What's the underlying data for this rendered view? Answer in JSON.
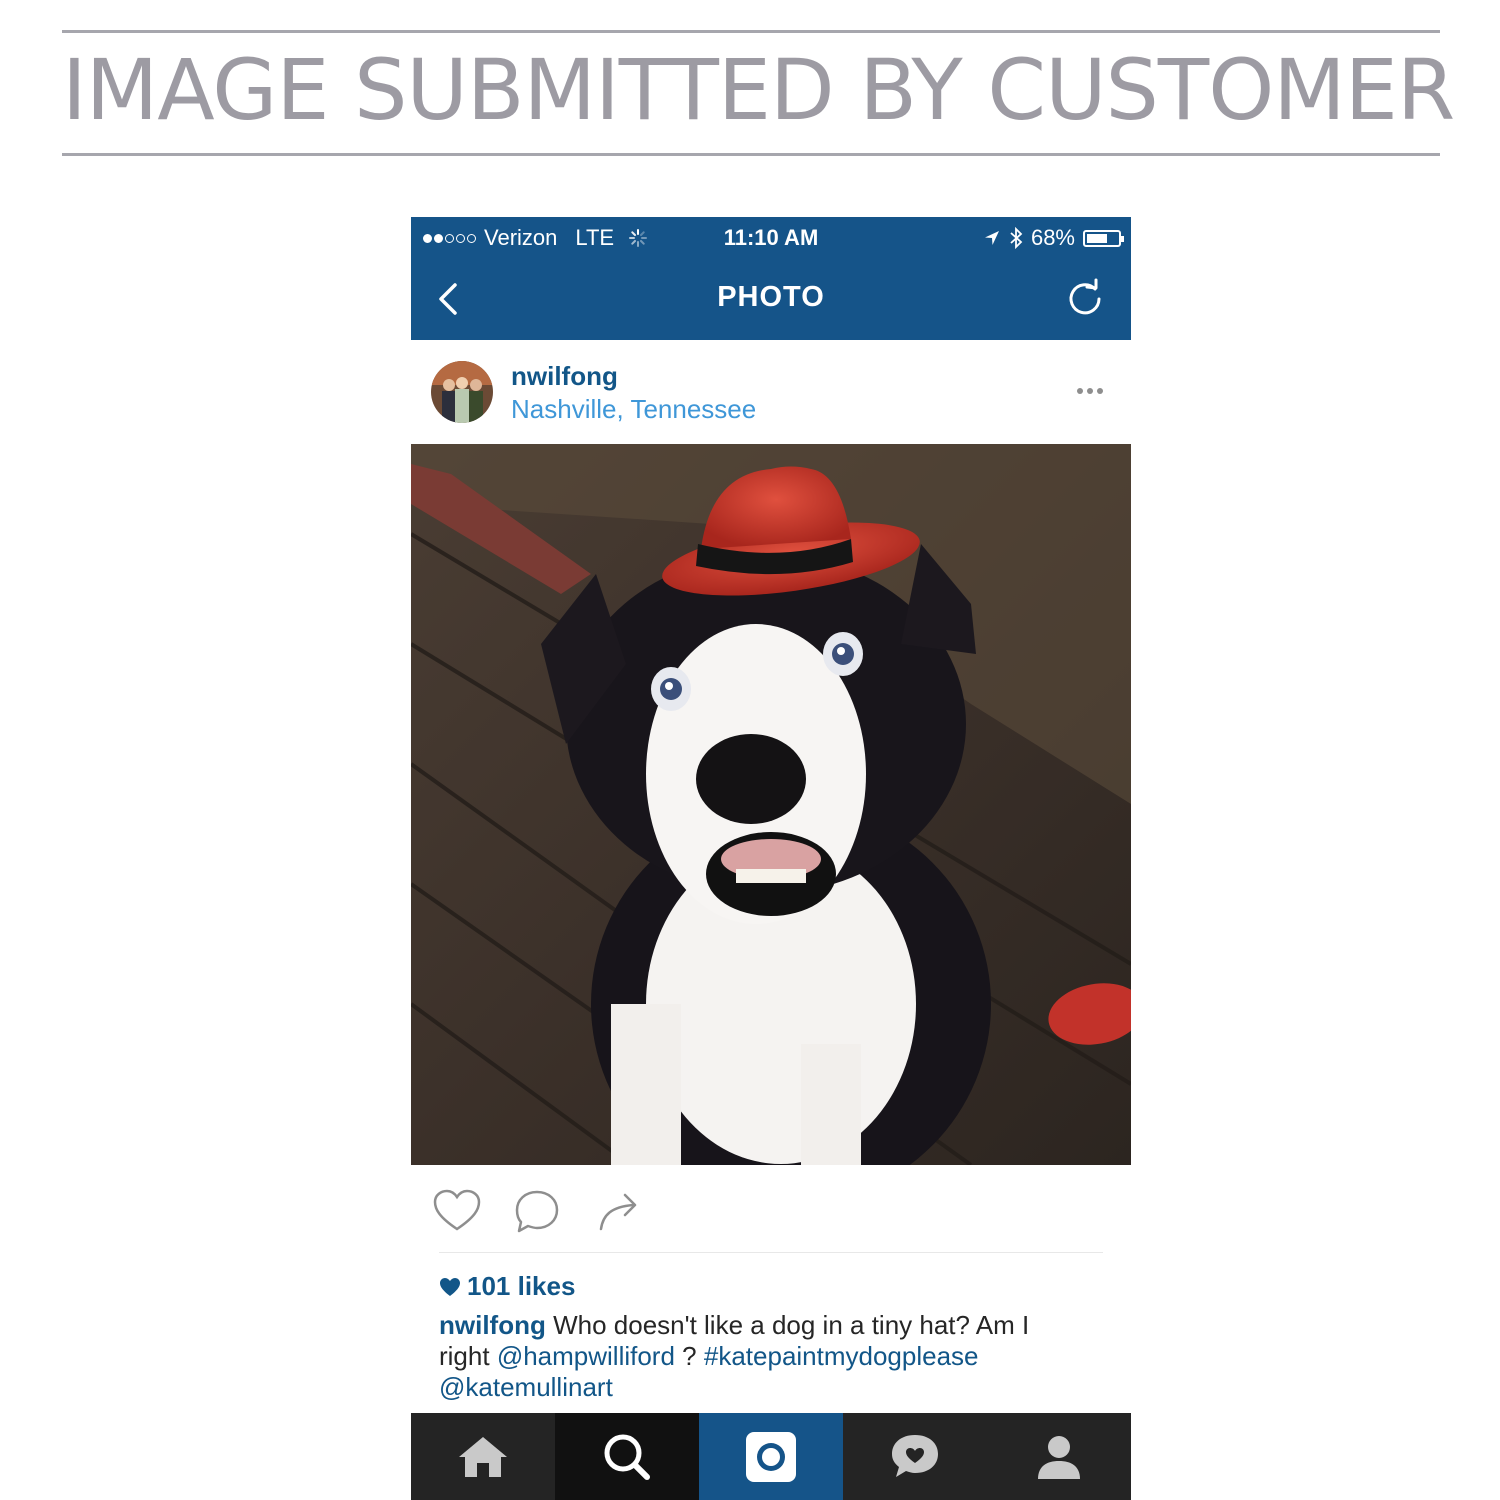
{
  "banner": {
    "title": "IMAGE SUBMITTED BY CUSTOMER"
  },
  "status_bar": {
    "carrier": "Verizon",
    "network": "LTE",
    "time": "11:10 AM",
    "battery": "68%",
    "battery_level": 0.68,
    "signal_bars_filled": 2,
    "signal_bars_total": 5
  },
  "nav": {
    "title": "PHOTO",
    "back_icon": "chevron-left-icon",
    "refresh_icon": "refresh-icon"
  },
  "post": {
    "username": "nwilfong",
    "location": "Nashville, Tennessee",
    "likes": "101 likes",
    "caption": {
      "username": "nwilfong",
      "text": "Who doesn't like a dog in a tiny hat? Am I right",
      "mention1": "@hampwilliford",
      "sep": "?",
      "hashtag": "#katepaintmydogplease",
      "mention2": "@katemullinart"
    }
  },
  "tabs": [
    "home-icon",
    "search-icon",
    "camera-icon",
    "activity-icon",
    "profile-icon"
  ],
  "colors": {
    "brand": "#155489",
    "link": "#125688",
    "location": "#3f97d8",
    "banner_text": "#9d9ba3"
  }
}
